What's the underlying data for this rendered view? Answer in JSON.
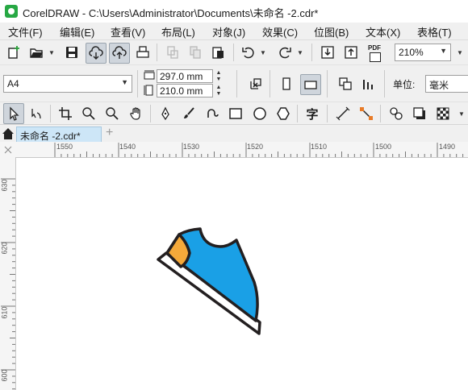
{
  "window": {
    "title": "CorelDRAW - C:\\Users\\Administrator\\Documents\\未命名 -2.cdr*"
  },
  "menu": [
    "文件(F)",
    "编辑(E)",
    "查看(V)",
    "布局(L)",
    "对象(J)",
    "效果(C)",
    "位图(B)",
    "文本(X)",
    "表格(T)"
  ],
  "standard_toolbar": {
    "zoom_value": "210%",
    "pdf_label": "PDF"
  },
  "property_bar": {
    "page_size": "A4",
    "width": "297.0 mm",
    "height": "210.0 mm",
    "units_label": "单位:",
    "units_value": "毫米"
  },
  "toolbox": {
    "text_tool_glyph": "字"
  },
  "document_tab": {
    "label": "未命名 -2.cdr*"
  },
  "ruler": {
    "horizontal": [
      "1550",
      "1540",
      "1530",
      "1520",
      "1510",
      "1500",
      "1490"
    ],
    "vertical": [
      "630",
      "620",
      "610",
      "600"
    ]
  },
  "colors": {
    "shoe_body": "#1aa0e6",
    "shoe_heel": "#f5a93a",
    "outline": "#231f20",
    "app_logo": "#27a844",
    "active_tab": "#cde6f7"
  }
}
